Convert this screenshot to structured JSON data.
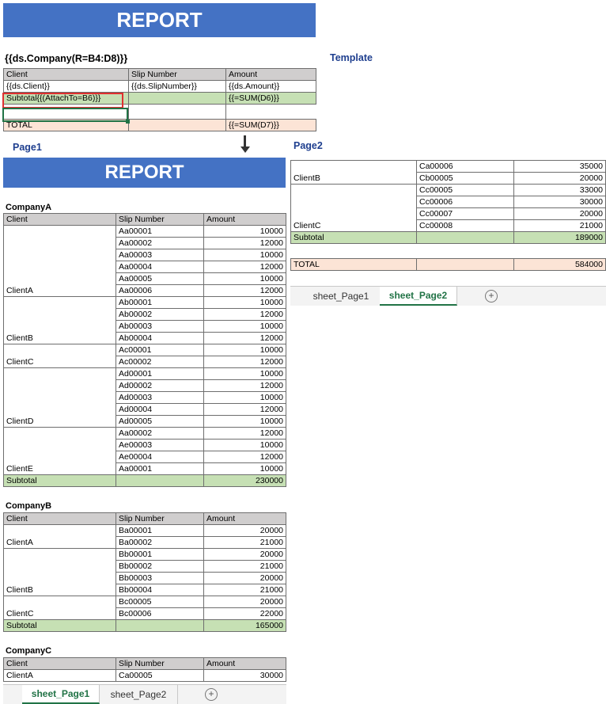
{
  "template": {
    "banner": "REPORT",
    "company_placeholder": "{{ds.Company(R=B4:D8)}}",
    "label": "Template",
    "headers": [
      "Client",
      "Slip Number",
      "Amount"
    ],
    "row": [
      "{{ds.Client}}",
      "{{ds.SlipNumber}}",
      "{{ds.Amount}}"
    ],
    "subtotal": [
      "Subtotal{{(AttachTo=B6)}}",
      "",
      "{{=SUM(D6)}}"
    ],
    "total": [
      "TOTAL",
      "",
      "{{=SUM(D7)}}"
    ]
  },
  "page1": {
    "label": "Page1",
    "banner": "REPORT",
    "headers": [
      "Client",
      "Slip Number",
      "Amount"
    ],
    "companyA": {
      "name": "CompanyA",
      "rows": [
        [
          "",
          "Aa00001",
          "10000"
        ],
        [
          "",
          "Aa00002",
          "12000"
        ],
        [
          "",
          "Aa00003",
          "10000"
        ],
        [
          "",
          "Aa00004",
          "12000"
        ],
        [
          "",
          "Aa00005",
          "10000"
        ],
        [
          "ClientA",
          "Aa00006",
          "12000"
        ],
        [
          "",
          "Ab00001",
          "10000"
        ],
        [
          "",
          "Ab00002",
          "12000"
        ],
        [
          "",
          "Ab00003",
          "10000"
        ],
        [
          "ClientB",
          "Ab00004",
          "12000"
        ],
        [
          "",
          "Ac00001",
          "10000"
        ],
        [
          "ClientC",
          "Ac00002",
          "12000"
        ],
        [
          "",
          "Ad00001",
          "10000"
        ],
        [
          "",
          "Ad00002",
          "12000"
        ],
        [
          "",
          "Ad00003",
          "10000"
        ],
        [
          "",
          "Ad00004",
          "12000"
        ],
        [
          "ClientD",
          "Ad00005",
          "10000"
        ],
        [
          "",
          "Aa00002",
          "12000"
        ],
        [
          "",
          "Ae00003",
          "10000"
        ],
        [
          "",
          "Ae00004",
          "12000"
        ],
        [
          "ClientE",
          "Aa00001",
          "10000"
        ]
      ],
      "subtotal": [
        "Subtotal",
        "",
        "230000"
      ]
    },
    "companyB": {
      "name": "CompanyB",
      "rows": [
        [
          "",
          "Ba00001",
          "20000"
        ],
        [
          "ClientA",
          "Ba00002",
          "21000"
        ],
        [
          "",
          "Bb00001",
          "20000"
        ],
        [
          "",
          "Bb00002",
          "21000"
        ],
        [
          "",
          "Bb00003",
          "20000"
        ],
        [
          "ClientB",
          "Bb00004",
          "21000"
        ],
        [
          "",
          "Bc00005",
          "20000"
        ],
        [
          "ClientC",
          "Bc00006",
          "22000"
        ]
      ],
      "subtotal": [
        "Subtotal",
        "",
        "165000"
      ]
    },
    "companyC": {
      "name": "CompanyC",
      "rows": [
        [
          "ClientA",
          "Ca00005",
          "30000"
        ]
      ]
    },
    "tabs": [
      "sheet_Page1",
      "sheet_Page2"
    ],
    "active_tab": "sheet_Page1"
  },
  "page2": {
    "label": "Page2",
    "rows": [
      [
        "",
        "Ca00006",
        "35000"
      ],
      [
        "ClientB",
        "Cb00005",
        "20000"
      ],
      [
        "",
        "Cc00005",
        "33000"
      ],
      [
        "",
        "Cc00006",
        "30000"
      ],
      [
        "",
        "Cc00007",
        "20000"
      ],
      [
        "ClientC",
        "Cc00008",
        "21000"
      ]
    ],
    "subtotal": [
      "Subtotal",
      "",
      "189000"
    ],
    "total": [
      "TOTAL",
      "",
      "584000"
    ],
    "tabs": [
      "sheet_Page1",
      "sheet_Page2"
    ],
    "active_tab": "sheet_Page2"
  },
  "icons": {
    "add_sheet": "plus-circle-icon",
    "flow_arrow": "arrow-down-icon"
  },
  "colors": {
    "banner": "#4472c4",
    "header": "#d0cece",
    "subtotal": "#c6e0b4",
    "total": "#fce4d6",
    "accent_green": "#217346",
    "highlight_red": "#e03030"
  }
}
